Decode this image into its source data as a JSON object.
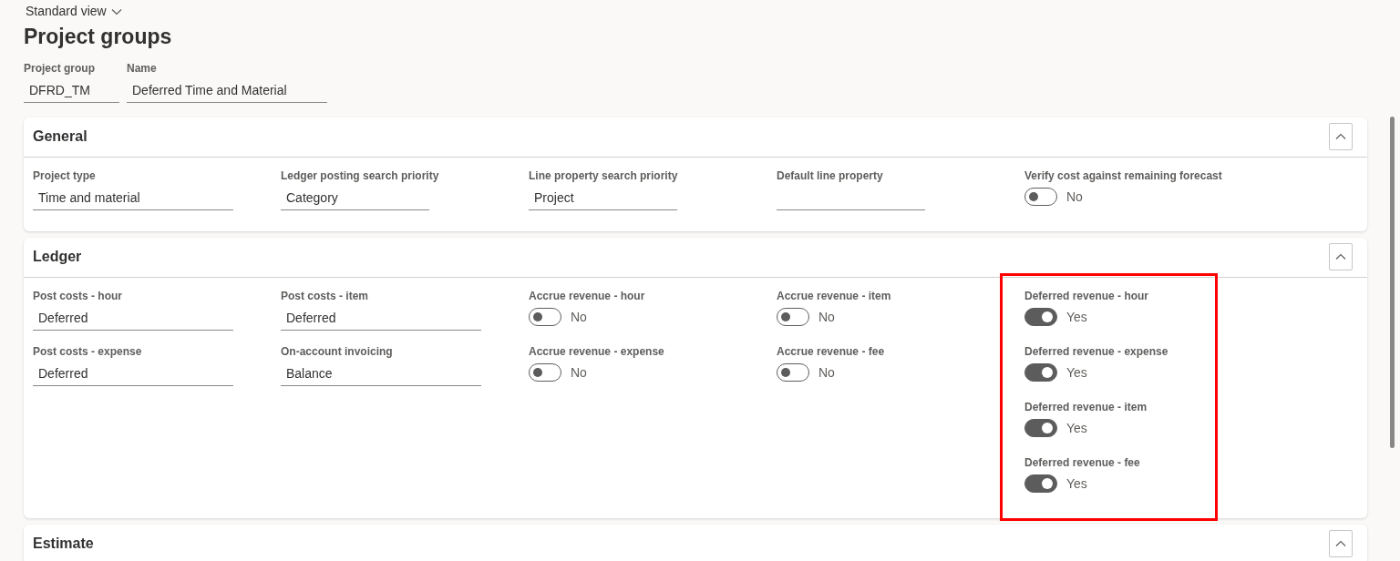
{
  "view_selector": {
    "label": "Standard view"
  },
  "page_title": "Project groups",
  "header_fields": [
    {
      "label": "Project group",
      "value": "DFRD_TM"
    },
    {
      "label": "Name",
      "value": "Deferred Time and Material"
    }
  ],
  "sections": [
    {
      "title": "General",
      "columns": [
        {
          "highlighted": false,
          "fields": [
            {
              "kind": "text",
              "label": "Project type",
              "value": "Time and material"
            }
          ]
        },
        {
          "highlighted": false,
          "fields": [
            {
              "kind": "text",
              "label": "Ledger posting search priority",
              "value": "Category"
            }
          ]
        },
        {
          "highlighted": false,
          "fields": [
            {
              "kind": "text",
              "label": "Line property search priority",
              "value": "Project"
            }
          ]
        },
        {
          "highlighted": false,
          "fields": [
            {
              "kind": "text",
              "label": "Default line property"
            }
          ]
        },
        {
          "highlighted": false,
          "fields": [
            {
              "kind": "toggle",
              "label": "Verify cost against remaining forecast",
              "on": false,
              "text": "No"
            }
          ]
        }
      ]
    },
    {
      "title": "Ledger",
      "columns": [
        {
          "highlighted": false,
          "fields": [
            {
              "kind": "text",
              "label": "Post costs - hour",
              "value": "Deferred"
            },
            {
              "kind": "text",
              "label": "Post costs - expense",
              "value": "Deferred"
            }
          ]
        },
        {
          "highlighted": false,
          "fields": [
            {
              "kind": "text",
              "label": "Post costs - item",
              "value": "Deferred"
            },
            {
              "kind": "text",
              "label": "On-account invoicing",
              "value": "Balance"
            }
          ]
        },
        {
          "highlighted": false,
          "fields": [
            {
              "kind": "toggle",
              "label": "Accrue revenue - hour",
              "on": false,
              "text": "No"
            },
            {
              "kind": "toggle",
              "label": "Accrue revenue - expense",
              "on": false,
              "text": "No"
            }
          ]
        },
        {
          "highlighted": false,
          "fields": [
            {
              "kind": "toggle",
              "label": "Accrue revenue - item",
              "on": false,
              "text": "No"
            },
            {
              "kind": "toggle",
              "label": "Accrue revenue - fee",
              "on": false,
              "text": "No"
            }
          ]
        },
        {
          "highlighted": true,
          "fields": [
            {
              "kind": "toggle",
              "label": "Deferred revenue - hour",
              "on": true,
              "text": "Yes"
            },
            {
              "kind": "toggle",
              "label": "Deferred revenue - expense",
              "on": true,
              "text": "Yes"
            },
            {
              "kind": "toggle",
              "label": "Deferred revenue - item",
              "on": true,
              "text": "Yes"
            },
            {
              "kind": "toggle",
              "label": "Deferred revenue - fee",
              "on": true,
              "text": "Yes"
            }
          ]
        }
      ]
    },
    {
      "title": "Estimate"
    }
  ]
}
